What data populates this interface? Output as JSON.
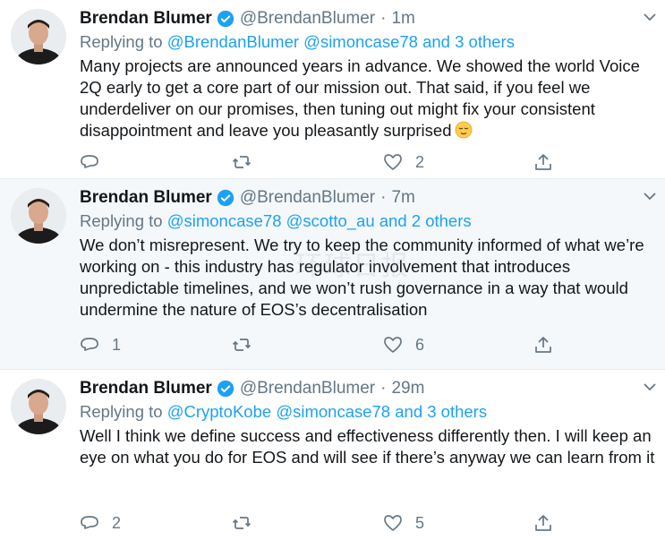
{
  "tweets": [
    {
      "name": "Brendan Blumer",
      "handle": "@BrendanBlumer",
      "separator": "·",
      "time": "1m",
      "replying_prefix": "Replying to",
      "replying_to": "@BrendanBlumer @simoncase78 and 3 others",
      "text": "Many projects are announced years in advance. We showed the world Voice 2Q early to get a core part of our mission out. That said, if you feel we underdeliver on our promises, then tuning out might fix your consistent disappointment and leave you pleasantly surprised",
      "has_emoji": true,
      "reply_count": "",
      "retweet_count": "",
      "like_count": "2"
    },
    {
      "name": "Brendan Blumer",
      "handle": "@BrendanBlumer",
      "separator": "·",
      "time": "7m",
      "replying_prefix": "Replying to",
      "replying_to": "@simoncase78 @scotto_au and 2 others",
      "text": "We don’t misrepresent. We try to keep the community informed of what we’re working on - this industry has regulator involvement that introduces unpredictable timelines, and we won’t rush governance in a way that would undermine the nature of EOS’s decentralisation",
      "has_emoji": false,
      "reply_count": "1",
      "retweet_count": "",
      "like_count": "6"
    },
    {
      "name": "Brendan Blumer",
      "handle": "@BrendanBlumer",
      "separator": "·",
      "time": "29m",
      "replying_prefix": "Replying to",
      "replying_to": "@CryptoKobe @simoncase78 and 3 others",
      "text": "Well I think we define success and effectiveness differently then. I will keep an eye on what you do for EOS and will see if there’s anyway we can learn from it",
      "has_emoji": false,
      "reply_count": "2",
      "retweet_count": "",
      "like_count": "5"
    }
  ],
  "watermark": "环球日报",
  "colors": {
    "link": "#1da1f2",
    "secondary": "#657786",
    "text": "#14171a",
    "highlight_bg": "#f5f8fa"
  },
  "icons": [
    "verified-badge-icon",
    "chevron-down-icon",
    "reply-icon",
    "retweet-icon",
    "like-icon",
    "share-icon",
    "relieved-face-emoji"
  ]
}
